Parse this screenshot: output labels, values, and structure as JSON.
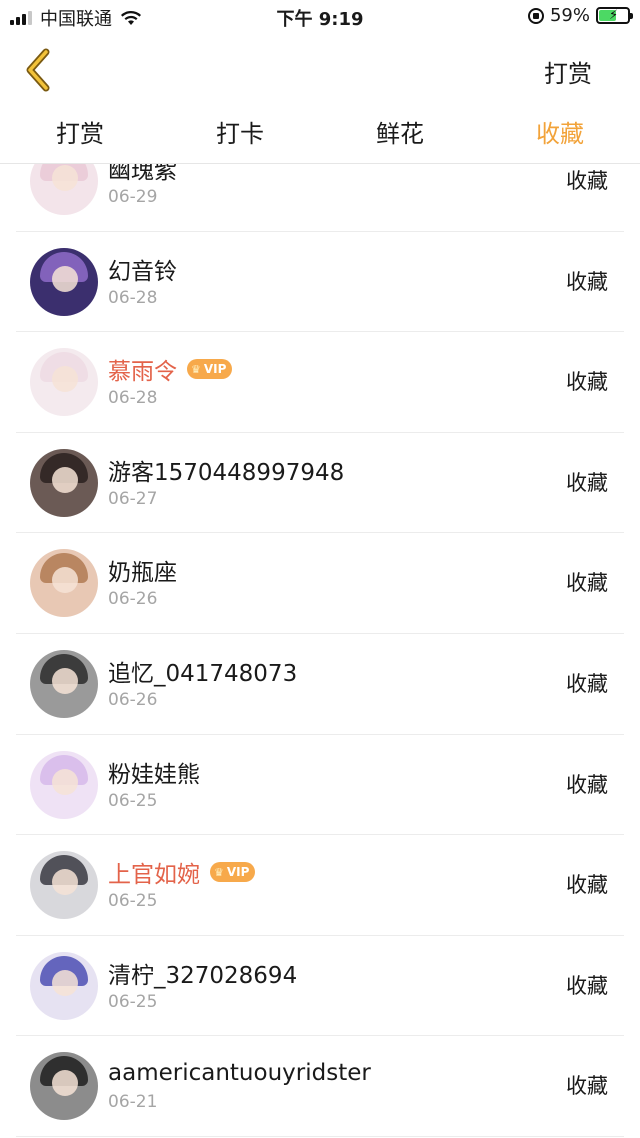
{
  "status_bar": {
    "carrier": "中国联通",
    "time": "下午 9:19",
    "battery_percent": "59%",
    "battery_level": 0.59,
    "icons": [
      "signal-icon",
      "wifi-icon",
      "rotation-lock-icon",
      "battery-icon"
    ]
  },
  "nav": {
    "back_icon": "chevron-left-icon",
    "action_label": "打赏",
    "accent": "#f2a33a"
  },
  "tabs": [
    {
      "label": "打赏",
      "active": false
    },
    {
      "label": "打卡",
      "active": false
    },
    {
      "label": "鲜花",
      "active": false
    },
    {
      "label": "收藏",
      "active": true
    }
  ],
  "colors": {
    "tab_active": "#f2a33a",
    "vip_name": "#e3634a",
    "vip_badge": "#f7a94b",
    "date_text": "#a5a5a5",
    "divider": "#ececec"
  },
  "list": {
    "items": [
      {
        "name": "幽瑰紫",
        "date": "06-29",
        "action": "收藏",
        "vip": false,
        "avatar_bg": "#f3e4ea",
        "avatar_hair": "#e9c9d6"
      },
      {
        "name": "幻音铃",
        "date": "06-28",
        "action": "收藏",
        "vip": false,
        "avatar_bg": "#3b2f6e",
        "avatar_hair": "#8f6bc9"
      },
      {
        "name": "慕雨令",
        "date": "06-28",
        "action": "收藏",
        "vip": true,
        "vip_label": "VIP",
        "avatar_bg": "#f4eaee",
        "avatar_hair": "#eddbe3"
      },
      {
        "name": "游客1570448997948",
        "date": "06-27",
        "action": "收藏",
        "vip": false,
        "avatar_bg": "#6b5a55",
        "avatar_hair": "#2a2120"
      },
      {
        "name": "奶瓶座",
        "date": "06-26",
        "action": "收藏",
        "vip": false,
        "avatar_bg": "#e8c8b4",
        "avatar_hair": "#b07a52"
      },
      {
        "name": "追忆_041748073",
        "date": "06-26",
        "action": "收藏",
        "vip": false,
        "avatar_bg": "#9a9a9a",
        "avatar_hair": "#2b2b2b"
      },
      {
        "name": "粉娃娃熊",
        "date": "06-25",
        "action": "收藏",
        "vip": false,
        "avatar_bg": "#efe2f5",
        "avatar_hair": "#d6b8ea"
      },
      {
        "name": "上官如婉",
        "date": "06-25",
        "action": "收藏",
        "vip": true,
        "vip_label": "VIP",
        "avatar_bg": "#d8d8dc",
        "avatar_hair": "#3a3a42"
      },
      {
        "name": "清柠_327028694",
        "date": "06-25",
        "action": "收藏",
        "vip": false,
        "avatar_bg": "#e6e2f2",
        "avatar_hair": "#4c4fb4"
      },
      {
        "name": "aamericantuouyridster",
        "date": "06-21",
        "action": "收藏",
        "vip": false,
        "avatar_bg": "#8c8c8c",
        "avatar_hair": "#1f1f1f"
      }
    ]
  }
}
